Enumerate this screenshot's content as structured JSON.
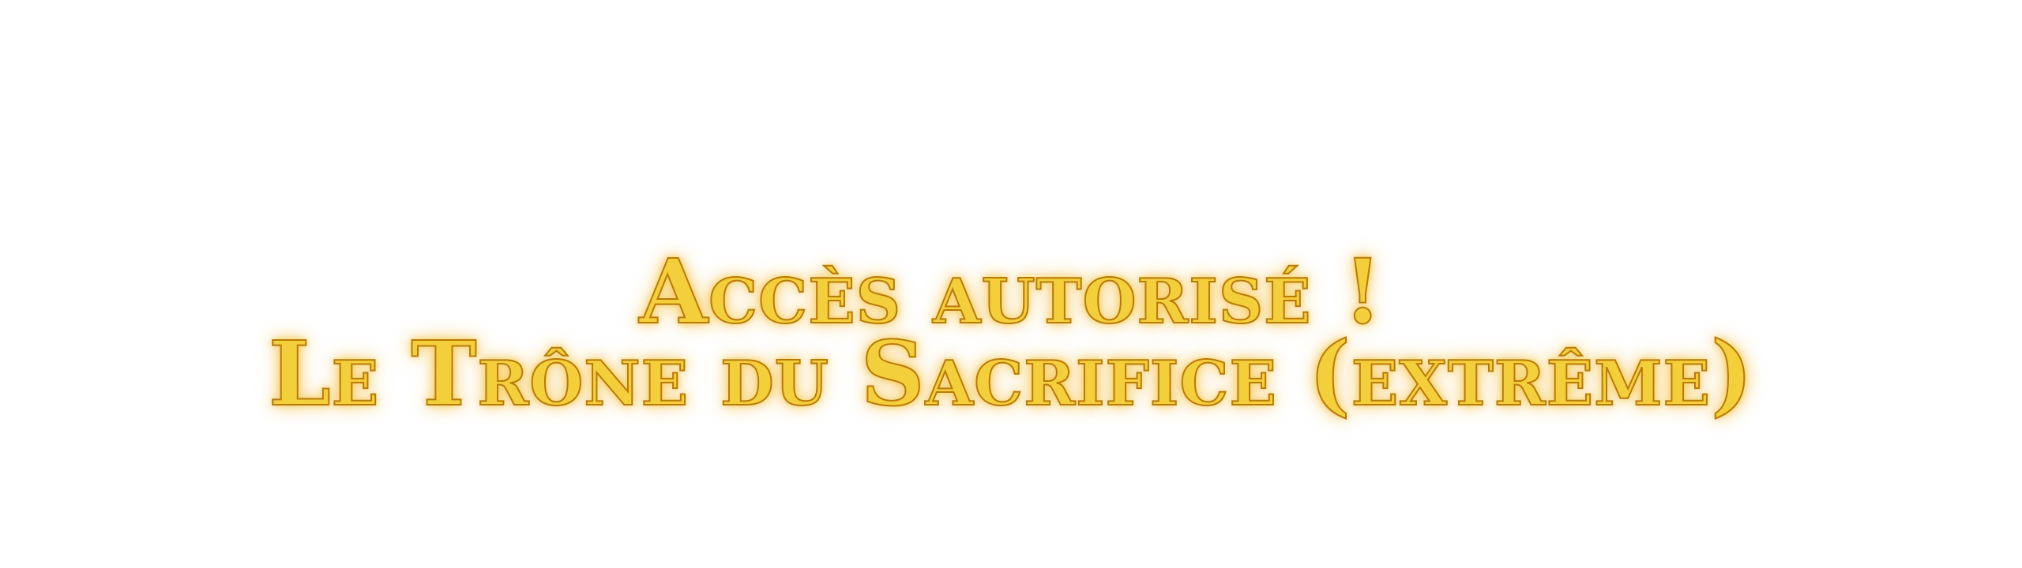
{
  "notification": {
    "line1": "Accès autorisé !",
    "line2": "Le Trône du Sacrifice (extrême)"
  },
  "colors": {
    "text_fill": "#f4cf3c",
    "text_outline": "#b97a08",
    "glow": "#f2ad14",
    "background": "#ffffff"
  }
}
